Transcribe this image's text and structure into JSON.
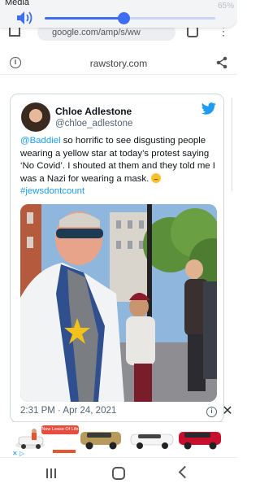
{
  "media": {
    "label": "Media",
    "volume_percent": 46,
    "battery_text": "65%"
  },
  "browser": {
    "url_text": "google.com/amp/s/ww"
  },
  "site": {
    "name": "rawstory.com"
  },
  "tweet": {
    "author_name": "Chloe Adlestone",
    "author_handle": "@chloe_adlestone",
    "mention": "@Baddiel",
    "body": " so horrific to see disgusting people wearing a yellow star at today’s protest saying ‘No Covid’. I shouted at them and they told me I was a Nazi for wearing a mask. ",
    "hashtag": "#jewsdontcount",
    "timestamp": "2:31 PM · Apr 24, 2021"
  },
  "ad": {
    "banner_text": "New Lease Of Life",
    "badge": "✕ ▷"
  },
  "colors": {
    "twitter_blue": "#1d9bf0",
    "slider_blue": "#3d6df2"
  }
}
